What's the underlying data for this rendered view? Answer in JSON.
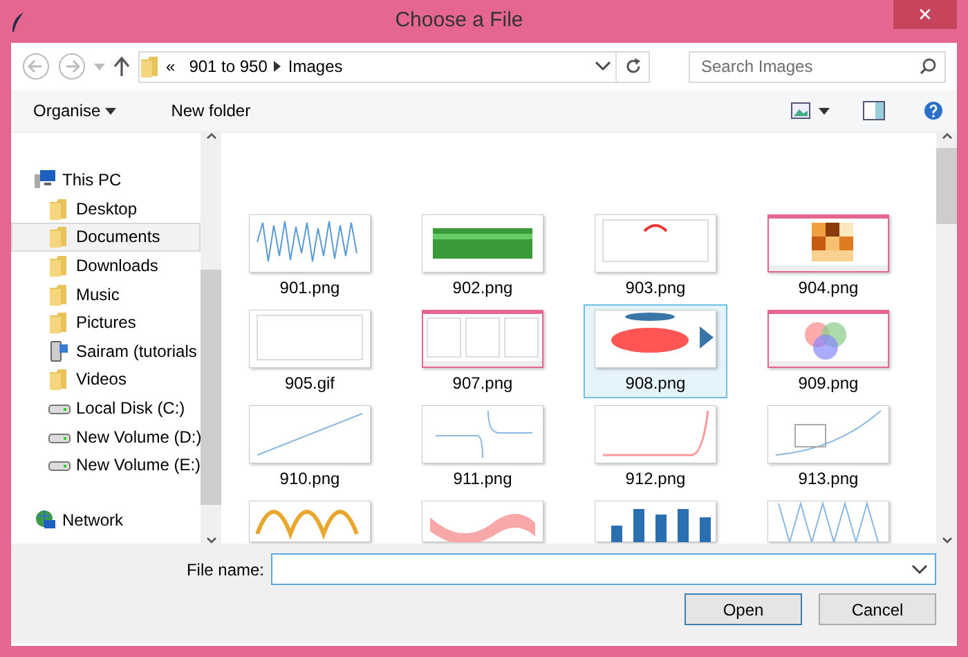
{
  "window": {
    "title": "Choose a File",
    "close": "✕"
  },
  "address": {
    "overflow": "«",
    "crumbs": [
      "901 to 950",
      "Images"
    ]
  },
  "search": {
    "placeholder": "Search Images"
  },
  "toolbar": {
    "organise": "Organise",
    "new_folder": "New folder"
  },
  "sidebar": {
    "items": [
      {
        "label": "This PC",
        "kind": "pc",
        "selected": false,
        "children": [
          {
            "label": "Desktop",
            "kind": "folder",
            "selected": false
          },
          {
            "label": "Documents",
            "kind": "folder",
            "selected": true
          },
          {
            "label": "Downloads",
            "kind": "folder",
            "selected": false
          },
          {
            "label": "Music",
            "kind": "folder",
            "selected": false
          },
          {
            "label": "Pictures",
            "kind": "folder",
            "selected": false
          },
          {
            "label": "Sairam (tutorials",
            "kind": "user",
            "selected": false
          },
          {
            "label": "Videos",
            "kind": "folder",
            "selected": false
          },
          {
            "label": "Local Disk (C:)",
            "kind": "drive",
            "selected": false
          },
          {
            "label": "New Volume (D:)",
            "kind": "drive",
            "selected": false
          },
          {
            "label": "New Volume (E:)",
            "kind": "drive",
            "selected": false
          }
        ]
      },
      {
        "label": "Network",
        "kind": "network",
        "selected": false
      }
    ]
  },
  "files": [
    {
      "label": "901.png",
      "selected": false
    },
    {
      "label": "902.png",
      "selected": false
    },
    {
      "label": "903.png",
      "selected": false
    },
    {
      "label": "904.png",
      "selected": false
    },
    {
      "label": "905.gif",
      "selected": false
    },
    {
      "label": "907.png",
      "selected": false
    },
    {
      "label": "908.png",
      "selected": true
    },
    {
      "label": "909.png",
      "selected": false
    },
    {
      "label": "910.png",
      "selected": false
    },
    {
      "label": "911.png",
      "selected": false
    },
    {
      "label": "912.png",
      "selected": false
    },
    {
      "label": "913.png",
      "selected": false
    },
    {
      "kind": "picture"
    },
    {
      "kind": "picture"
    },
    {
      "kind": "picture"
    },
    {
      "kind": "picture"
    }
  ],
  "file_name": {
    "label": "File name:"
  },
  "buttons": [
    {
      "label": "Open",
      "kind": "primary"
    },
    {
      "label": "Cancel",
      "kind": "secondary"
    }
  ]
}
